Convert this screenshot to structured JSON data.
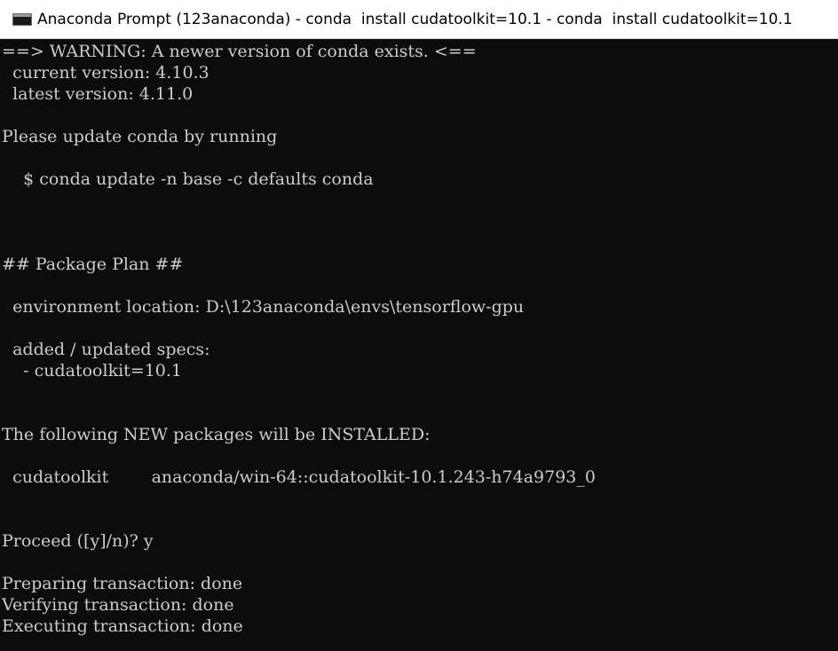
{
  "window": {
    "title": "Anaconda Prompt (123anaconda) - conda  install cudatoolkit=10.1 - conda  install cudatoolkit=10.1",
    "icon": "terminal-icon"
  },
  "console": {
    "colors": {
      "background": "#0c0c0c",
      "foreground": "#cccccc"
    },
    "lines": [
      "==> WARNING: A newer version of conda exists. <==",
      "  current version: 4.10.3",
      "  latest version: 4.11.0",
      "",
      "Please update conda by running",
      "",
      "    $ conda update -n base -c defaults conda",
      "",
      "",
      "",
      "## Package Plan ##",
      "",
      "  environment location: D:\\123anaconda\\envs\\tensorflow-gpu",
      "",
      "  added / updated specs:",
      "    - cudatoolkit=10.1",
      "",
      "",
      "The following NEW packages will be INSTALLED:",
      "",
      "  cudatoolkit        anaconda/win-64::cudatoolkit-10.1.243-h74a9793_0",
      "",
      "",
      "Proceed ([y]/n)? y",
      "",
      "Preparing transaction: done",
      "Verifying transaction: done",
      "Executing transaction: done"
    ]
  }
}
